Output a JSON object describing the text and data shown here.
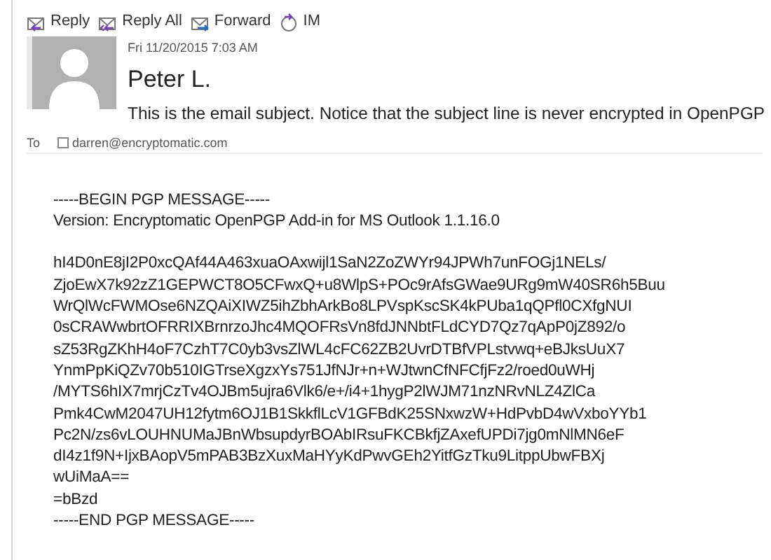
{
  "toolbar": [
    {
      "label": "Reply",
      "kind": "reply"
    },
    {
      "label": "Reply All",
      "kind": "reply_all"
    },
    {
      "label": "Forward",
      "kind": "forward"
    },
    {
      "label": "IM",
      "kind": "im"
    }
  ],
  "message": {
    "date": "Fri 11/20/2015 7:03 AM",
    "sender": "Peter L.",
    "subject": "This is the email subject. Notice that the subject line is never encrypted in OpenPGP",
    "to_label": "To",
    "recipients": [
      "darren@encryptomatic.com"
    ]
  },
  "body": [
    {
      "lines": [
        "-----BEGIN PGP MESSAGE-----",
        "Version: Encryptomatic OpenPGP Add-in for MS Outlook 1.1.16.0"
      ]
    },
    {
      "lines": [
        "hI4D0nE8jI2P0xcQAf44A463xuaOAxwijl1SaN2ZoZWYr94JPWh7unFOGj1NELs/",
        "ZjoEwX7k92zZ1GEPWCT8O5CFwxQ+u8WlpS+POc9rAfsGWae9URg9mW40SR6h5Buu",
        "WrQlWcFWMOse6NZQAiXIWZ5ihZbhArkBo8LPVspKscSK4kPUba1qQPfl0CXfgNUI",
        "0sCRAWwbrtOFRRIXBrnrzoJhc4MQOFRsVn8fdJNNbtFLdCYD7Qz7qApP0jZ892/o",
        "sZ53RgZKhH4oF7CzhT7C0yb3vsZlWL4cFC62ZB2UvrDTBfVPLstvwq+eBJksUuX7",
        "YnmPpKiQZv70b510IGTrseXgzxYs751JfNJr+n+WJtwnCfNFCfjFz2/roed0uWHj",
        "/MYTS6hIX7mrjCzTv4OJBm5ujra6Vlk6/e+/i4+1hygP2lWJM71nzNRvNLZ4ZlCa",
        "Pmk4CwM2047UH12fytm6OJ1B1SkkflLcV1GFBdK25SNxwzW+HdPvbD4wVxboYYb1",
        "Pc2N/zs6vLOUHNUMaJBnWbsupdyrBOAbIRsuFKCBkfjZAxefUPDi7jg0mNlMN6eF",
        "dI4z1f9N+IjxBAopV5mPAB3BzXuxMaHYyKdPwvGEh2YitfGzTku9LitppUbwFBXj",
        "wUiMaA==",
        "=bBzd",
        "-----END PGP MESSAGE-----"
      ]
    }
  ]
}
